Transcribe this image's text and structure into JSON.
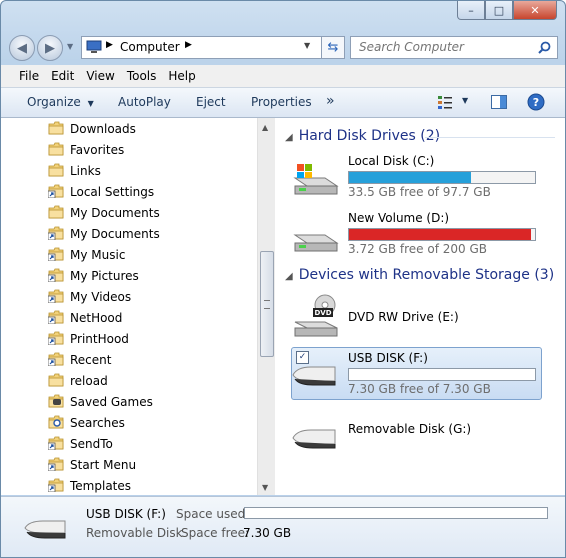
{
  "window": {
    "caption_buttons": {
      "minimize": "–",
      "maximize": "□",
      "close": "✕"
    }
  },
  "nav": {
    "back_icon": "back-arrow-icon",
    "forward_icon": "forward-arrow-icon",
    "address": {
      "label": "Computer"
    },
    "search": {
      "placeholder": "Search Computer"
    }
  },
  "menubar": {
    "items": [
      "File",
      "Edit",
      "View",
      "Tools",
      "Help"
    ]
  },
  "commandbar": {
    "organize": "Organize",
    "autoplay": "AutoPlay",
    "eject": "Eject",
    "properties": "Properties",
    "more": "»"
  },
  "navigation_pane": {
    "items": [
      {
        "label": "Downloads",
        "icon": "folder-icon"
      },
      {
        "label": "Favorites",
        "icon": "folder-icon"
      },
      {
        "label": "Links",
        "icon": "folder-icon"
      },
      {
        "label": "Local Settings",
        "icon": "shortcut-folder-icon"
      },
      {
        "label": "My Documents",
        "icon": "folder-icon"
      },
      {
        "label": "My Documents",
        "icon": "shortcut-folder-icon"
      },
      {
        "label": "My Music",
        "icon": "shortcut-folder-icon"
      },
      {
        "label": "My Pictures",
        "icon": "shortcut-folder-icon"
      },
      {
        "label": "My Videos",
        "icon": "shortcut-folder-icon"
      },
      {
        "label": "NetHood",
        "icon": "shortcut-folder-icon"
      },
      {
        "label": "PrintHood",
        "icon": "shortcut-folder-icon"
      },
      {
        "label": "Recent",
        "icon": "shortcut-folder-icon"
      },
      {
        "label": "reload",
        "icon": "folder-icon"
      },
      {
        "label": "Saved Games",
        "icon": "saved-games-folder-icon"
      },
      {
        "label": "Searches",
        "icon": "searches-folder-icon"
      },
      {
        "label": "SendTo",
        "icon": "shortcut-folder-icon"
      },
      {
        "label": "Start Menu",
        "icon": "shortcut-folder-icon"
      },
      {
        "label": "Templates",
        "icon": "shortcut-folder-icon"
      }
    ]
  },
  "content": {
    "groups": [
      {
        "header": "Hard Disk Drives (2)",
        "drives": [
          {
            "name": "Local Disk (C:)",
            "free_text": "33.5 GB free of 97.7 GB",
            "used_fraction": 0.657,
            "bar_color": "#26a0da",
            "icon": "system-drive-icon"
          },
          {
            "name": "New Volume (D:)",
            "free_text": "3.72 GB free of 200 GB",
            "used_fraction": 0.981,
            "bar_color": "#da2626",
            "icon": "hard-drive-icon"
          }
        ]
      },
      {
        "header": "Devices with Removable Storage (3)",
        "drives": [
          {
            "name": "DVD RW Drive (E:)",
            "icon": "dvd-drive-icon"
          },
          {
            "name": "USB DISK (F:)",
            "free_text": "7.30 GB free of 7.30 GB",
            "used_fraction": 0.0,
            "bar_color": "#26a0da",
            "icon": "usb-drive-icon",
            "selected": true
          },
          {
            "name": "Removable Disk (G:)",
            "icon": "usb-drive-icon"
          }
        ]
      }
    ]
  },
  "details": {
    "name": "USB DISK (F:)",
    "type": "Removable Disk",
    "space_used_label": "Space used:",
    "space_free_label": "Space free:",
    "space_free_value": "7.30 GB",
    "used_fraction": 0.0
  }
}
